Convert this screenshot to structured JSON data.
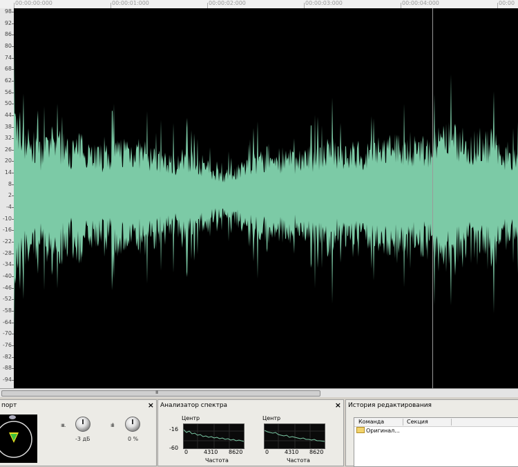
{
  "ruler": {
    "labels": [
      "00:00:00:000",
      "00:00:01:000",
      "00:00:02:000",
      "00:00:03:000",
      "00:00:04:000",
      "00:00"
    ]
  },
  "vscale": {
    "labels": [
      "98",
      "92",
      "86",
      "80",
      "74",
      "68",
      "62",
      "56",
      "50",
      "44",
      "38",
      "32",
      "26",
      "20",
      "14",
      "8",
      "2",
      "-4",
      "-10",
      "-16",
      "-22",
      "-28",
      "-34",
      "-40",
      "-46",
      "-52",
      "-58",
      "-64",
      "-70",
      "-76",
      "-82",
      "-88",
      "-94"
    ]
  },
  "waveform": {
    "color": "#7ccaa6",
    "background": "#000000",
    "playhead_color": "#9a9a9a"
  },
  "transport": {
    "title": "порт",
    "knob1_label": "-3 дБ",
    "knob2_label": "0 %"
  },
  "spectrum": {
    "title": "Анализатор спектра",
    "chart1": {
      "center_label": "Центр",
      "y_ticks": [
        "-16",
        "-60"
      ],
      "x_ticks": [
        "0",
        "4310",
        "8620"
      ],
      "xlabel": "Частота"
    },
    "chart2": {
      "center_label": "Центр",
      "x_ticks": [
        "0",
        "4310",
        "8620"
      ],
      "xlabel": "Частота"
    }
  },
  "history": {
    "title": "История редактирования",
    "columns": [
      "Команда",
      "Секция"
    ],
    "rows": [
      {
        "command": "Оригинал...",
        "section": ""
      }
    ]
  },
  "close_glyph": "×",
  "scroll_grip": "III"
}
